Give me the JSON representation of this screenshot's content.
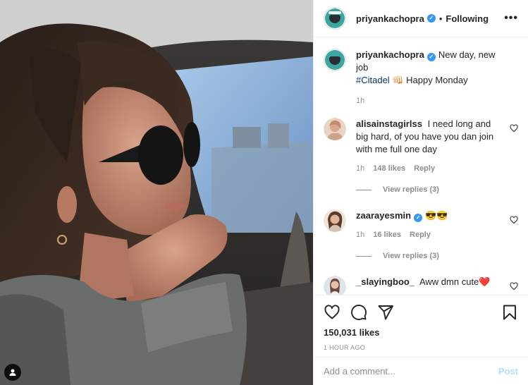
{
  "header": {
    "username": "priyankachopra",
    "separator": "•",
    "follow_label": "Following",
    "more_label": "•••"
  },
  "caption": {
    "username": "priyankachopra",
    "text_before": "New day, new job",
    "hashtag": "#Citadel",
    "emoji": "👊🏻",
    "text_after": "Happy Monday",
    "time": "1h"
  },
  "comments": [
    {
      "username": "alisainstagirlss",
      "text": "I need long and big hard, of you have you dan join with me full one day",
      "time": "1h",
      "likes": "148 likes",
      "reply_label": "Reply",
      "view_replies": "View replies (3)"
    },
    {
      "username": "zaarayesmin",
      "text": "😎😎",
      "time": "1h",
      "likes": "16 likes",
      "reply_label": "Reply",
      "view_replies": "View replies (3)"
    },
    {
      "username": "_slayingboo_",
      "text": "Aww dmn cute❤️"
    }
  ],
  "actions": {
    "likes_count": "150,031 likes",
    "posted_time": "1 HOUR AGO"
  },
  "add_comment": {
    "placeholder": "Add a comment...",
    "post_label": "Post"
  },
  "icons": {
    "like": "heart-icon",
    "comment": "comment-bubble-icon",
    "share": "paper-plane-icon",
    "save": "bookmark-icon",
    "tag": "person-tag-icon",
    "verified": "verified-badge-icon",
    "comment_like": "small-heart-icon"
  },
  "colors": {
    "verified": "#3897f0",
    "hashtag": "#00376b",
    "secondary_text": "#8e8e8e",
    "post_button_disabled": "#b2dffc",
    "heart_red": "#ed4956"
  }
}
